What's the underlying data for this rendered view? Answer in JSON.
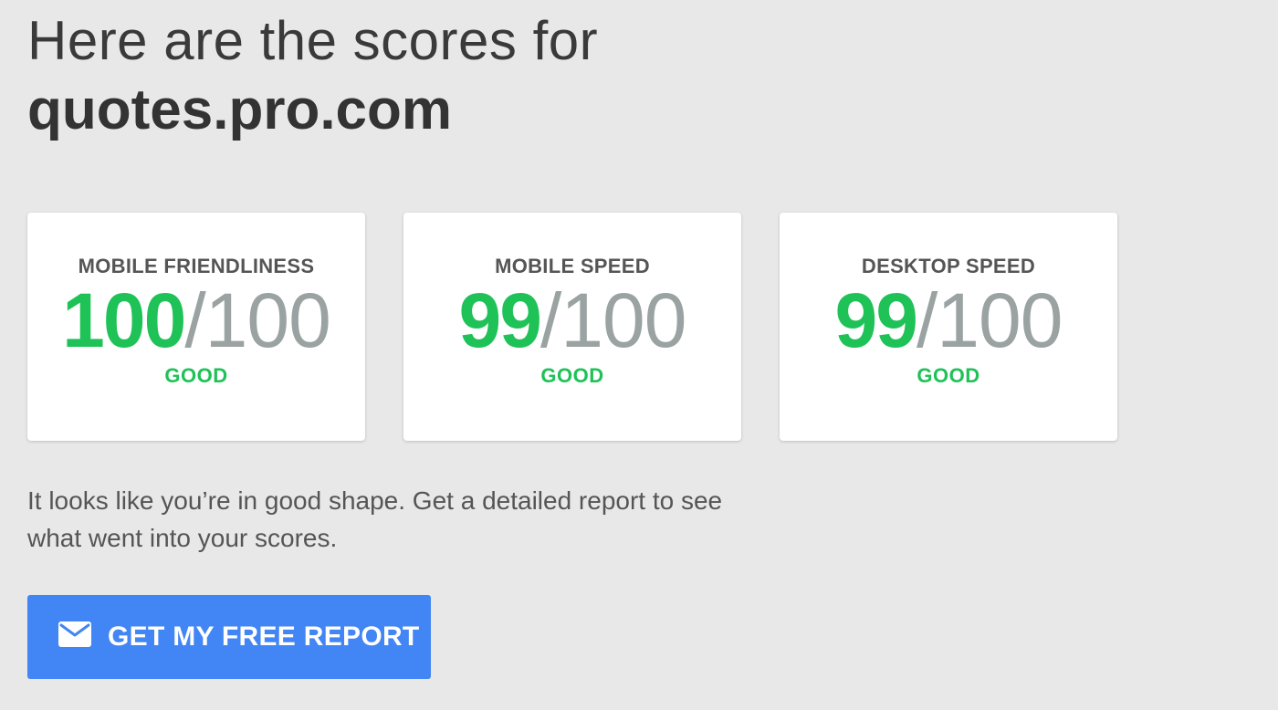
{
  "heading": {
    "prefix": "Here are the scores for",
    "domain": "quotes.pro.com"
  },
  "cards": [
    {
      "label": "MOBILE FRIENDLINESS",
      "score": "100",
      "max": "/100",
      "status": "GOOD"
    },
    {
      "label": "MOBILE SPEED",
      "score": "99",
      "max": "/100",
      "status": "GOOD"
    },
    {
      "label": "DESKTOP SPEED",
      "score": "99",
      "max": "/100",
      "status": "GOOD"
    }
  ],
  "summary": "It looks like you’re in good shape. Get a detailed report to see what went into your scores.",
  "cta": {
    "label": "GET MY FREE REPORT",
    "icon": "mail-icon"
  },
  "colors": {
    "good": "#1ec257",
    "cta_background": "#4285f4",
    "page_background": "#e8e8e8"
  }
}
